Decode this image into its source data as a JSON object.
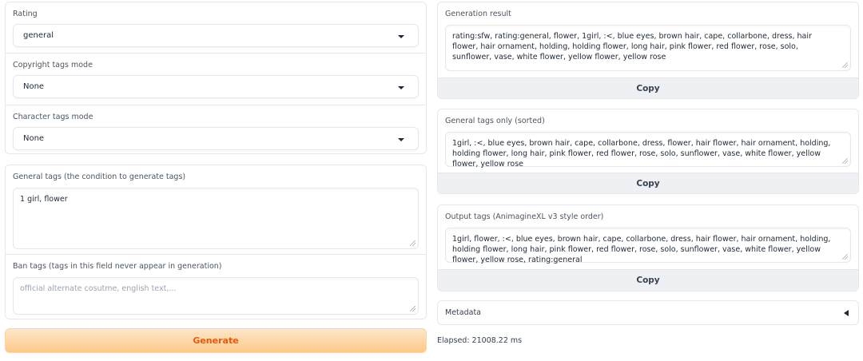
{
  "left": {
    "rating": {
      "label": "Rating",
      "value": "general"
    },
    "copyright": {
      "label": "Copyright tags mode",
      "value": "None"
    },
    "character": {
      "label": "Character tags mode",
      "value": "None"
    },
    "general_tags": {
      "label": "General tags (the condition to generate tags)",
      "value": "1 girl, flower"
    },
    "ban_tags": {
      "label": "Ban tags (tags in this field never appear in generation)",
      "value": "",
      "placeholder": "official alternate cosutme, english text,..."
    },
    "generate_label": "Generate"
  },
  "right": {
    "generation_result": {
      "label": "Generation result",
      "value": "rating:sfw, rating:general, flower, 1girl, :<, blue eyes, brown hair, cape, collarbone, dress, hair flower, hair ornament, holding, holding flower, long hair, pink flower, red flower, rose, solo, sunflower, vase, white flower, yellow flower, yellow rose",
      "copy_label": "Copy"
    },
    "general_sorted": {
      "label": "General tags only (sorted)",
      "value": "1girl, :<, blue eyes, brown hair, cape, collarbone, dress, flower, hair flower, hair ornament, holding, holding flower, long hair, pink flower, red flower, rose, solo, sunflower, vase, white flower, yellow flower, yellow rose",
      "copy_label": "Copy"
    },
    "output_tags": {
      "label": "Output tags (AnimagineXL v3 style order)",
      "value": "1girl, flower, :<, blue eyes, brown hair, cape, collarbone, dress, hair flower, hair ornament, holding, holding flower, long hair, pink flower, red flower, rose, solo, sunflower, vase, white flower, yellow flower, yellow rose, rating:general",
      "copy_label": "Copy"
    },
    "metadata_label": "Metadata",
    "elapsed": "Elapsed: 21008.22 ms"
  },
  "colors": {
    "generate_text": "#ea580c",
    "generate_bg_top": "#fde7c7",
    "generate_bg_bottom": "#fcc98a",
    "border": "#e5e7eb",
    "copy_bg": "#eef0f3"
  },
  "icons": {
    "dropdown": "chevron-down-icon",
    "resize": "resize-grip-icon",
    "collapse": "triangle-left-icon"
  }
}
